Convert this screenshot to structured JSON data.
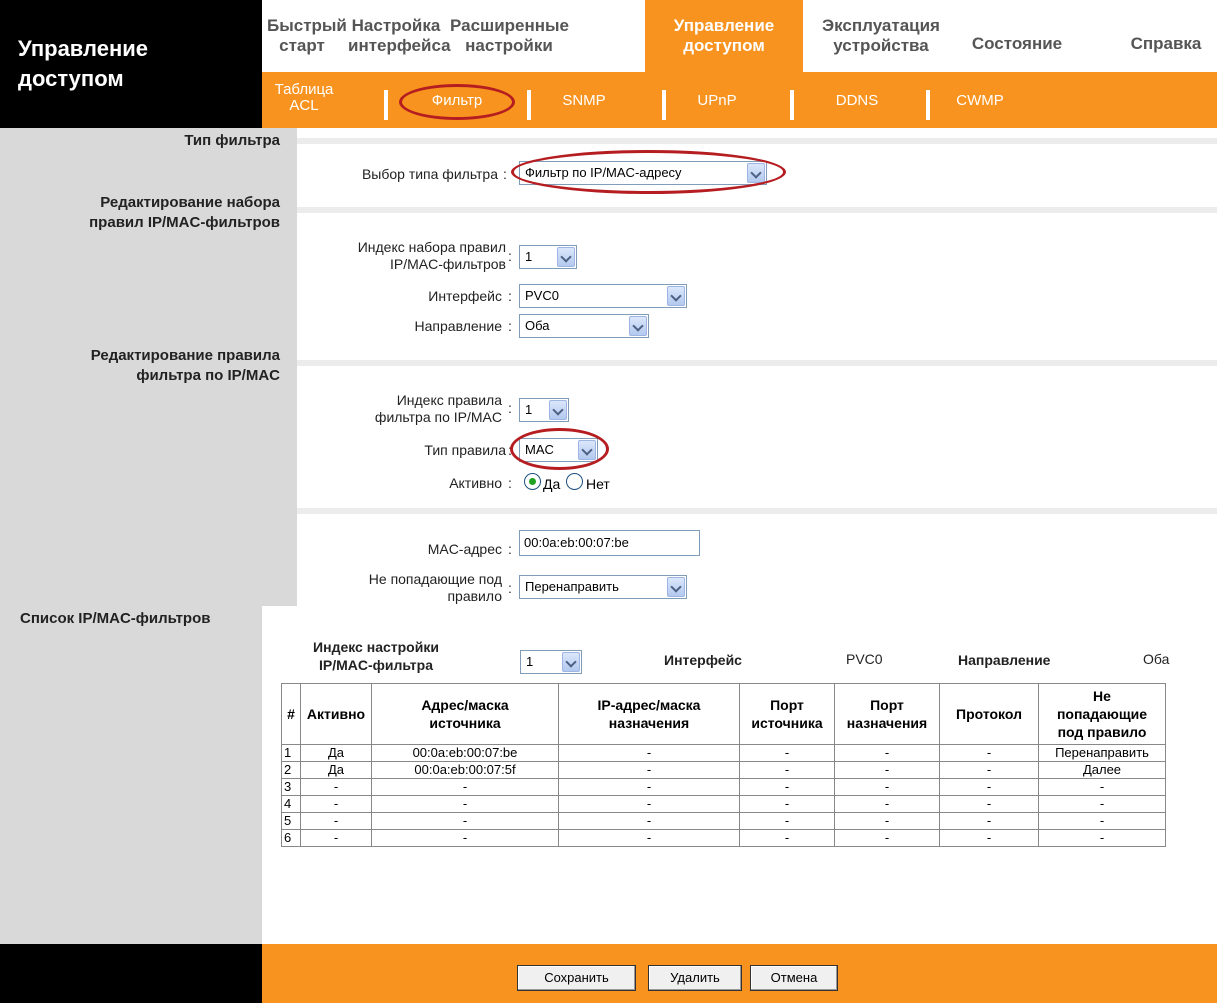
{
  "brand": {
    "title": "Управление\nдоступом"
  },
  "top_nav": [
    {
      "label": "Быстрый\nстарт"
    },
    {
      "label": "Настройка\nинтерфейса"
    },
    {
      "label": "Расширенные\nнастройки"
    },
    {
      "label": "Управление\nдоступом"
    },
    {
      "label": "Эксплуатация\nустройства"
    },
    {
      "label": "Состояние"
    },
    {
      "label": "Справка"
    }
  ],
  "sub_nav": [
    {
      "label": "Таблица\nACL"
    },
    {
      "label": "Фильтр"
    },
    {
      "label": "SNMP"
    },
    {
      "label": "UPnP"
    },
    {
      "label": "DDNS"
    },
    {
      "label": "CWMP"
    }
  ],
  "sections": {
    "filter_type": "Тип фильтра",
    "ruleset_edit": "Редактирование набора\nправил IP/MAC-фильтров",
    "rule_edit": "Редактирование правила\nфильтра по IP/MAC",
    "list": "Список IP/MAC-фильтров"
  },
  "form": {
    "filter_type_label": "Выбор типа фильтра",
    "filter_type_value": "Фильтр по IP/MAC-адресу",
    "ruleset_index_label": "Индекс набора правил\nIP/MAC-фильтров",
    "ruleset_index_value": "1",
    "interface_label": "Интерфейс",
    "interface_value": "PVC0",
    "direction_label": "Направление",
    "direction_value": "Оба",
    "rule_index_label": "Индекс правила\nфильтра по IP/MAC",
    "rule_index_value": "1",
    "rule_type_label": "Тип правила",
    "rule_type_value": "MAC",
    "active_label": "Активно",
    "active_yes": "Да",
    "active_no": "Нет",
    "mac_label": "MAC-адрес",
    "mac_value": "00:0a:eb:00:07:be",
    "unmatched_label": "Не попадающие под\nправило",
    "unmatched_value": "Перенаправить",
    "colon": ":"
  },
  "summary": {
    "index_label": "Индекс настройки\nIP/MAC-фильтра",
    "index_value": "1",
    "interface_label": "Интерфейс",
    "interface_value": "PVC0",
    "direction_label": "Направление",
    "direction_value": "Оба"
  },
  "table": {
    "headers": [
      "#",
      "Активно",
      "Адрес/маска\nисточника",
      "IP-адрес/маска\nназначения",
      "Порт\nисточника",
      "Порт\nназначения",
      "Протокол",
      "Не\nпопадающие\nпод правило"
    ],
    "rows": [
      [
        "1",
        "Да",
        "00:0a:eb:00:07:be",
        "-",
        "-",
        "-",
        "-",
        "Перенаправить"
      ],
      [
        "2",
        "Да",
        "00:0a:eb:00:07:5f",
        "-",
        "-",
        "-",
        "-",
        "Далее"
      ],
      [
        "3",
        "-",
        "-",
        "-",
        "-",
        "-",
        "-",
        "-"
      ],
      [
        "4",
        "-",
        "-",
        "-",
        "-",
        "-",
        "-",
        "-"
      ],
      [
        "5",
        "-",
        "-",
        "-",
        "-",
        "-",
        "-",
        "-"
      ],
      [
        "6",
        "-",
        "-",
        "-",
        "-",
        "-",
        "-",
        "-"
      ]
    ]
  },
  "buttons": {
    "save": "Сохранить",
    "delete": "Удалить",
    "cancel": "Отмена"
  },
  "colors": {
    "accent": "#f7931e",
    "highlight": "#b51d20",
    "panel": "#d9d9d9"
  }
}
